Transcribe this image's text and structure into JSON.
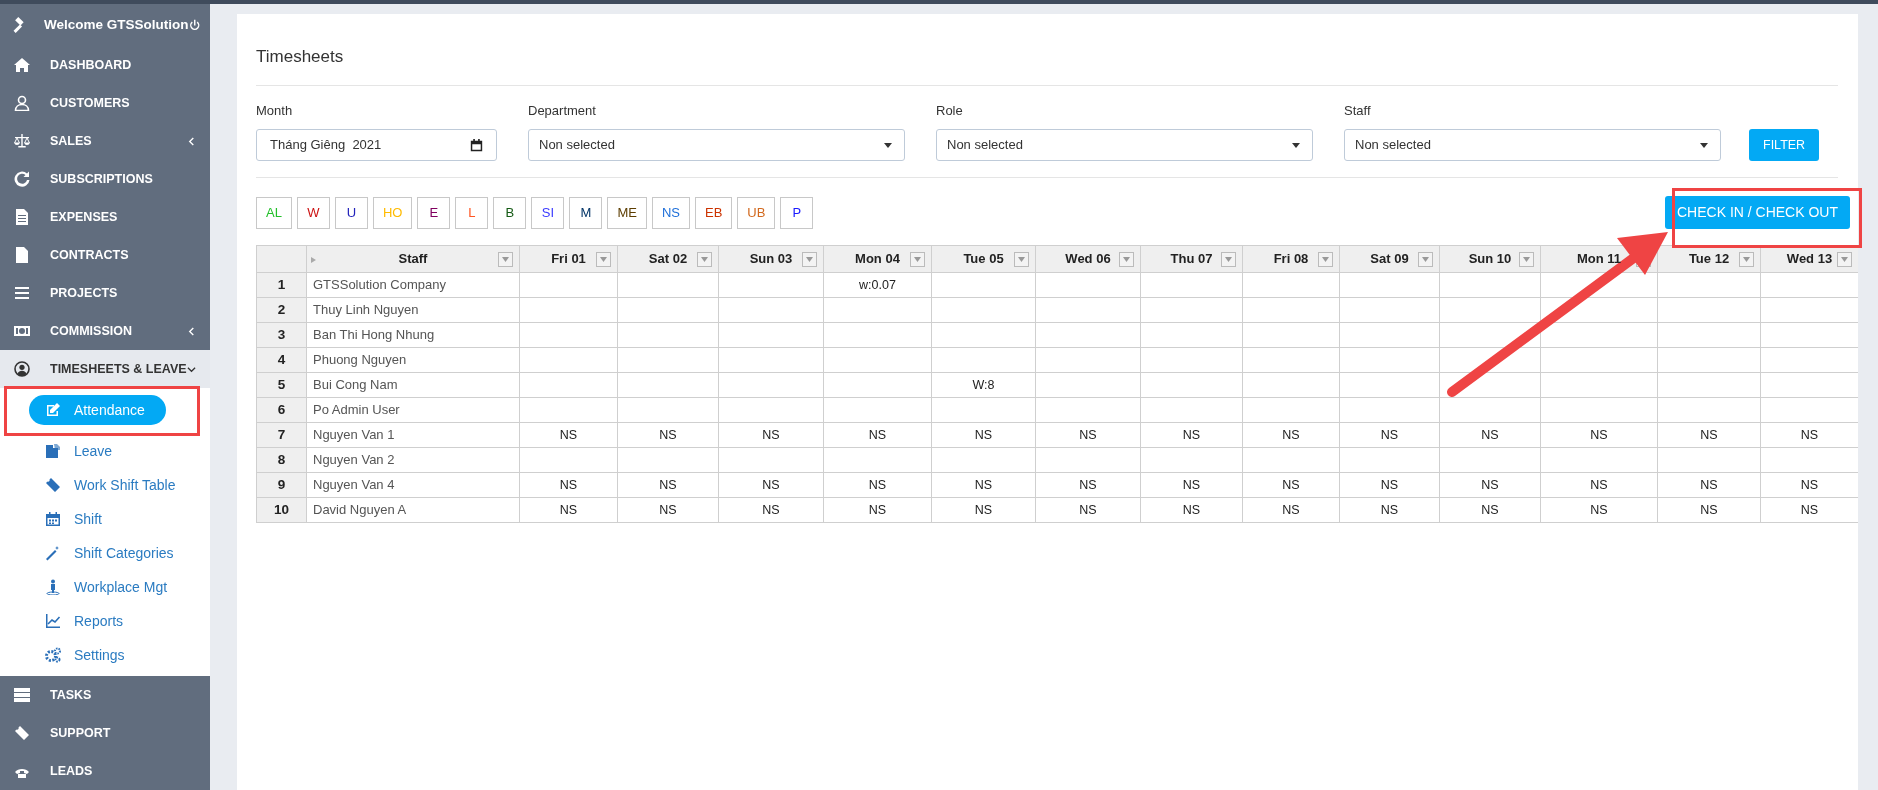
{
  "sidebar": {
    "header": {
      "title": "Welcome GTSSolution"
    },
    "items": [
      {
        "label": "DASHBOARD",
        "has_submenu": false,
        "expanded": false
      },
      {
        "label": "CUSTOMERS",
        "has_submenu": false,
        "expanded": false
      },
      {
        "label": "SALES",
        "has_submenu": true,
        "expanded": false
      },
      {
        "label": "SUBSCRIPTIONS",
        "has_submenu": false,
        "expanded": false
      },
      {
        "label": "EXPENSES",
        "has_submenu": false,
        "expanded": false
      },
      {
        "label": "CONTRACTS",
        "has_submenu": false,
        "expanded": false
      },
      {
        "label": "PROJECTS",
        "has_submenu": false,
        "expanded": false
      },
      {
        "label": "COMMISSION",
        "has_submenu": true,
        "expanded": false
      },
      {
        "label": "TIMESHEETS & LEAVE",
        "has_submenu": true,
        "expanded": true,
        "children": [
          {
            "label": "Attendance",
            "selected": true
          },
          {
            "label": "Leave",
            "selected": false
          },
          {
            "label": "Work Shift Table",
            "selected": false
          },
          {
            "label": "Shift",
            "selected": false
          },
          {
            "label": "Shift Categories",
            "selected": false
          },
          {
            "label": "Workplace Mgt",
            "selected": false
          },
          {
            "label": "Reports",
            "selected": false
          },
          {
            "label": "Settings",
            "selected": false
          }
        ]
      },
      {
        "label": "TASKS",
        "has_submenu": false,
        "expanded": false
      },
      {
        "label": "SUPPORT",
        "has_submenu": false,
        "expanded": false
      },
      {
        "label": "LEADS",
        "has_submenu": false,
        "expanded": false
      }
    ]
  },
  "page": {
    "title": "Timesheets"
  },
  "filters": [
    {
      "label": "Month",
      "kind": "date",
      "value": "Tháng Giêng  2021"
    },
    {
      "label": "Department",
      "kind": "select",
      "value": "Non selected"
    },
    {
      "label": "Role",
      "kind": "select",
      "value": "Non selected"
    },
    {
      "label": "Staff",
      "kind": "select",
      "value": "Non selected"
    }
  ],
  "filter_button": "FILTER",
  "legend": [
    {
      "code": "AL",
      "color": "#22c02a"
    },
    {
      "code": "W",
      "color": "#cc1111"
    },
    {
      "code": "U",
      "color": "#2222bb"
    },
    {
      "code": "HO",
      "color": "#ffbb00"
    },
    {
      "code": "E",
      "color": "#800060"
    },
    {
      "code": "L",
      "color": "#ff5522"
    },
    {
      "code": "B",
      "color": "#145a14"
    },
    {
      "code": "SI",
      "color": "#3b3bff"
    },
    {
      "code": "M",
      "color": "#003366"
    },
    {
      "code": "ME",
      "color": "#5c3d00"
    },
    {
      "code": "NS",
      "color": "#1e6fd9"
    },
    {
      "code": "EB",
      "color": "#cc3300"
    },
    {
      "code": "UB",
      "color": "#d2691e"
    },
    {
      "code": "P",
      "color": "#1a1aff"
    }
  ],
  "check_button": "CHECK IN / CHECK OUT",
  "table": {
    "columns": [
      "",
      "Staff",
      "Fri 01",
      "Sat 02",
      "Sun 03",
      "Mon 04",
      "Tue 05",
      "Wed 06",
      "Thu 07",
      "Fri 08",
      "Sat 09",
      "Sun 10",
      "Mon 11",
      "Tue 12",
      "Wed 13"
    ],
    "rows": [
      {
        "cells": [
          "1",
          "GTSSolution Company",
          "",
          "",
          "",
          "w:0.07",
          "",
          "",
          "",
          "",
          "",
          "",
          "",
          "",
          ""
        ]
      },
      {
        "cells": [
          "2",
          "Thuy Linh Nguyen",
          "",
          "",
          "",
          "",
          "",
          "",
          "",
          "",
          "",
          "",
          "",
          "",
          ""
        ]
      },
      {
        "cells": [
          "3",
          "Ban Thi Hong Nhung",
          "",
          "",
          "",
          "",
          "",
          "",
          "",
          "",
          "",
          "",
          "",
          "",
          ""
        ]
      },
      {
        "cells": [
          "4",
          "Phuong Nguyen",
          "",
          "",
          "",
          "",
          "",
          "",
          "",
          "",
          "",
          "",
          "",
          "",
          ""
        ]
      },
      {
        "cells": [
          "5",
          "Bui Cong Nam",
          "",
          "",
          "",
          "",
          "W:8",
          "",
          "",
          "",
          "",
          "",
          "",
          "",
          ""
        ]
      },
      {
        "cells": [
          "6",
          "Po Admin User",
          "",
          "",
          "",
          "",
          "",
          "",
          "",
          "",
          "",
          "",
          "",
          "",
          ""
        ]
      },
      {
        "cells": [
          "7",
          "Nguyen Van 1",
          "NS",
          "NS",
          "NS",
          "NS",
          "NS",
          "NS",
          "NS",
          "NS",
          "NS",
          "NS",
          "NS",
          "NS",
          "NS"
        ]
      },
      {
        "cells": [
          "8",
          "Nguyen Van 2",
          "",
          "",
          "",
          "",
          "",
          "",
          "",
          "",
          "",
          "",
          "",
          "",
          ""
        ]
      },
      {
        "cells": [
          "9",
          "Nguyen Van 4",
          "NS",
          "NS",
          "NS",
          "NS",
          "NS",
          "NS",
          "NS",
          "NS",
          "NS",
          "NS",
          "NS",
          "NS",
          "NS"
        ]
      },
      {
        "cells": [
          "10",
          "David Nguyen A",
          "NS",
          "NS",
          "NS",
          "NS",
          "NS",
          "NS",
          "NS",
          "NS",
          "NS",
          "NS",
          "NS",
          "NS",
          "NS"
        ]
      }
    ]
  }
}
